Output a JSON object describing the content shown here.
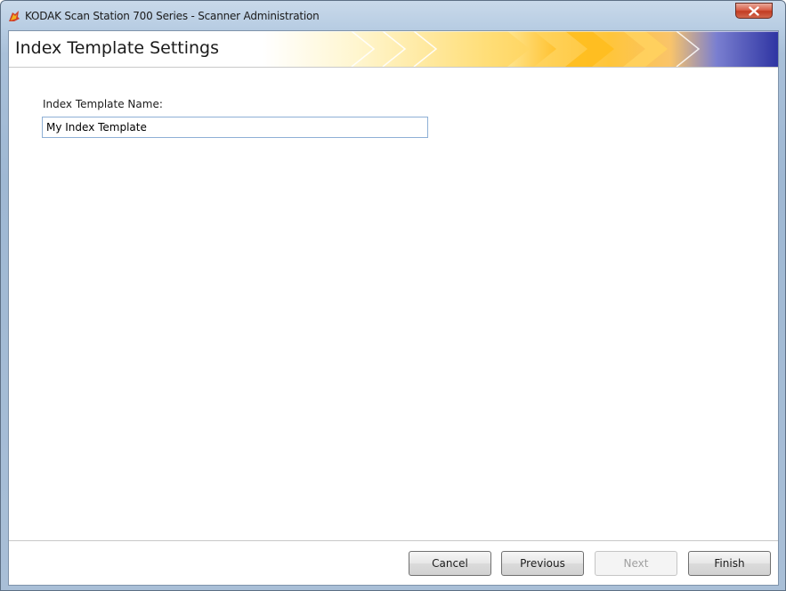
{
  "window": {
    "title": "KODAK Scan Station 700 Series - Scanner Administration",
    "app_icon": "kodak-logo-icon",
    "close_icon": "close-icon"
  },
  "header": {
    "title": "Index Template Settings"
  },
  "form": {
    "name_label": "Index Template Name:",
    "name_value": "My Index Template"
  },
  "footer": {
    "cancel_label": "Cancel",
    "previous_label": "Previous",
    "next_label": "Next",
    "finish_label": "Finish",
    "next_enabled": false
  },
  "colors": {
    "banner_start": "#fff6c8",
    "banner_mid": "#ffc23a",
    "banner_end": "#3a3fa8",
    "close_button": "#c8452b"
  }
}
